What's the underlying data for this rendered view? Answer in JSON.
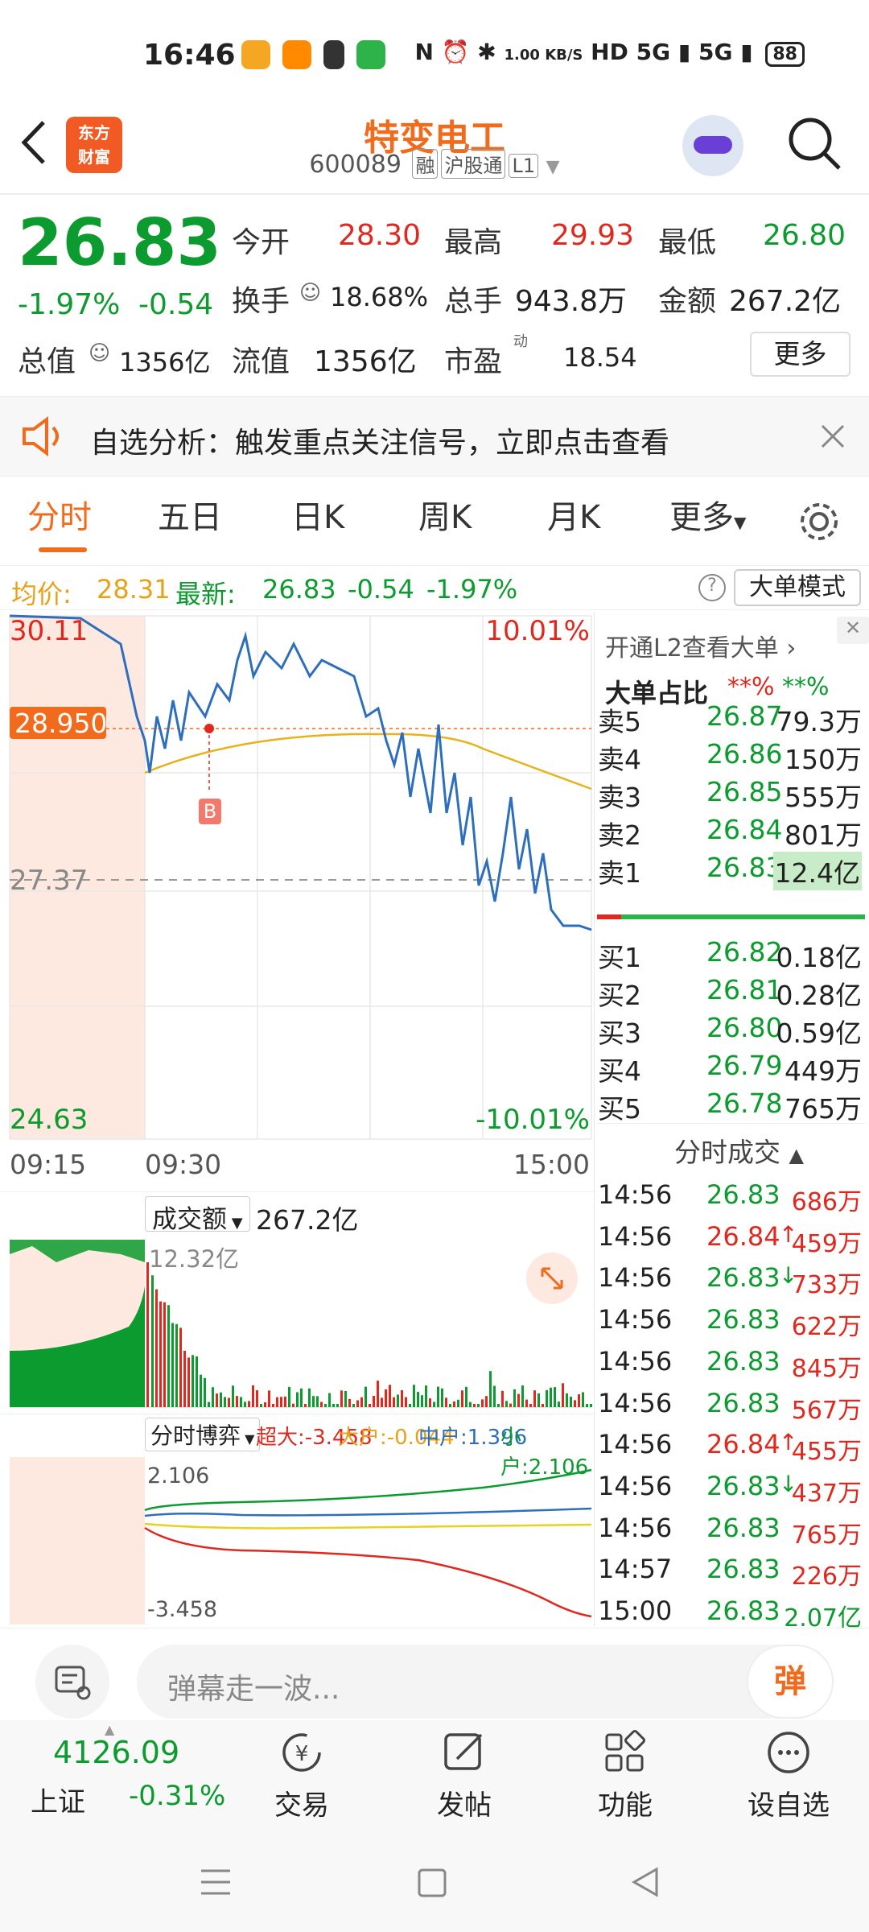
{
  "status_bar": {
    "time": "16:46",
    "net_speed": "1.00\nKB/S",
    "battery": "88",
    "signal1": "5G",
    "signal2": "5G"
  },
  "header": {
    "logo": "东方\n财富",
    "title": "特变电工",
    "code": "600089",
    "tags": [
      "融",
      "沪股通",
      "L1"
    ]
  },
  "quote": {
    "price": "26.83",
    "change_pct": "-1.97%",
    "change": "-0.54",
    "open_label": "今开",
    "open": "28.30",
    "high_label": "最高",
    "high": "29.93",
    "low_label": "最低",
    "low": "26.80",
    "turnover_label": "换手",
    "turnover": "18.68%",
    "volume_label": "总手",
    "volume": "943.8万",
    "amount_label": "金额",
    "amount": "267.2亿",
    "mcap_label": "总值",
    "mcap": "1356亿",
    "float_label": "流值",
    "float": "1356亿",
    "pe_label": "市盈",
    "pe_sup": "动",
    "pe": "18.54",
    "more": "更多"
  },
  "banner": {
    "text": "自选分析：触发重点关注信号，立即点击查看"
  },
  "tabs": [
    "分时",
    "五日",
    "日K",
    "周K",
    "月K",
    "更多"
  ],
  "info_line": {
    "avg_label": "均价:",
    "avg": "28.31",
    "latest_label": "最新:",
    "latest": "26.83",
    "chg": "-0.54",
    "pct": "-1.97%",
    "mode_btn": "大单模式"
  },
  "chart": {
    "max": "30.11",
    "marker": "28.950",
    "base": "27.37",
    "min": "24.63",
    "up_pct": "10.01%",
    "down_pct": "-10.01%",
    "t_start": "09:15",
    "t_open": "09:30",
    "t_end": "15:00",
    "buy_marker": "B",
    "colors": {
      "price": "#2e6fbd",
      "avg": "#e8b21a",
      "pre_market_bg": "#fde9df"
    }
  },
  "volume": {
    "label": "成交额",
    "value": "267.2亿",
    "max": "12.32亿"
  },
  "game": {
    "label": "分时博弈",
    "super": "超大:-3.458",
    "large": "大户:-0.044",
    "mid": "中户:1.396",
    "small": "小户:2.106",
    "top": "2.106",
    "bottom": "-3.458"
  },
  "orderbook": {
    "l2_link": "开通L2查看大单",
    "big_ratio_label": "大单占比",
    "r1": "**%",
    "r2": "**%",
    "asks": [
      {
        "label": "卖5",
        "price": "26.87",
        "vol": "79.3万"
      },
      {
        "label": "卖4",
        "price": "26.86",
        "vol": "150万"
      },
      {
        "label": "卖3",
        "price": "26.85",
        "vol": "555万"
      },
      {
        "label": "卖2",
        "price": "26.84",
        "vol": "801万"
      },
      {
        "label": "卖1",
        "price": "26.83",
        "vol": "12.4亿"
      }
    ],
    "bids": [
      {
        "label": "买1",
        "price": "26.82",
        "vol": "0.18亿"
      },
      {
        "label": "买2",
        "price": "26.81",
        "vol": "0.28亿"
      },
      {
        "label": "买3",
        "price": "26.80",
        "vol": "0.59亿"
      },
      {
        "label": "买4",
        "price": "26.79",
        "vol": "449万"
      },
      {
        "label": "买5",
        "price": "26.78",
        "vol": "765万"
      }
    ]
  },
  "trades": {
    "title": "分时成交",
    "rows": [
      {
        "t": "14:56",
        "p": "26.83",
        "v": "686万",
        "d": ""
      },
      {
        "t": "14:56",
        "p": "26.84",
        "v": "459万",
        "d": "↑"
      },
      {
        "t": "14:56",
        "p": "26.83",
        "v": "733万",
        "d": "↓"
      },
      {
        "t": "14:56",
        "p": "26.83",
        "v": "622万",
        "d": ""
      },
      {
        "t": "14:56",
        "p": "26.83",
        "v": "845万",
        "d": ""
      },
      {
        "t": "14:56",
        "p": "26.83",
        "v": "567万",
        "d": ""
      },
      {
        "t": "14:56",
        "p": "26.84",
        "v": "455万",
        "d": "↑"
      },
      {
        "t": "14:56",
        "p": "26.83",
        "v": "437万",
        "d": "↓"
      },
      {
        "t": "14:56",
        "p": "26.83",
        "v": "765万",
        "d": ""
      },
      {
        "t": "14:57",
        "p": "26.83",
        "v": "226万",
        "d": ""
      },
      {
        "t": "15:00",
        "p": "26.83",
        "v": "2.07亿",
        "d": ""
      }
    ]
  },
  "comment": {
    "placeholder": "弹幕走一波...",
    "danmu": "弹"
  },
  "bottom_nav": {
    "index_value": "4126.09",
    "index_name": "上证",
    "index_pct": "-0.31%",
    "items": [
      "交易",
      "发帖",
      "功能",
      "设自选"
    ]
  }
}
